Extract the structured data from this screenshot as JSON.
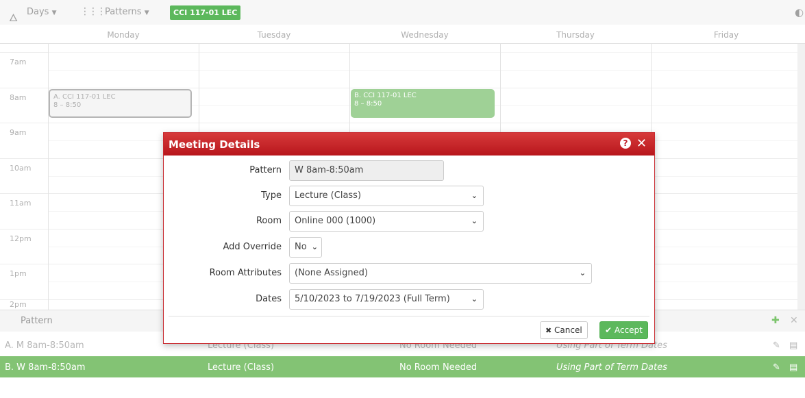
{
  "toolbar": {
    "days_label": "Days",
    "patterns_label": "Patterns",
    "course_badge": "CCI 117-01 LEC",
    "icons": [
      "fire-icon",
      "grid-icon",
      "chevron-down-icon",
      "refresh-icon"
    ]
  },
  "days": [
    "Monday",
    "Tuesday",
    "Wednesday",
    "Thursday",
    "Friday"
  ],
  "times": [
    "7am",
    "8am",
    "9am",
    "10am",
    "11am",
    "12pm",
    "1pm",
    "2pm"
  ],
  "events": {
    "a": {
      "title": "A. CCI 117-01 LEC",
      "time": "8 – 8:50"
    },
    "b": {
      "title": "B. CCI 117-01 LEC",
      "time": "8 – 8:50"
    }
  },
  "modal": {
    "title": "Meeting Details",
    "fields": {
      "pattern": {
        "label": "Pattern",
        "value": "W 8am-8:50am"
      },
      "type": {
        "label": "Type",
        "value": "Lecture (Class)"
      },
      "room": {
        "label": "Room",
        "value": "Online 000 (1000)"
      },
      "override": {
        "label": "Add Override",
        "value": "No"
      },
      "attributes": {
        "label": "Room Attributes",
        "value": "(None Assigned)"
      },
      "dates": {
        "label": "Dates",
        "value": "5/10/2023 to 7/19/2023 (Full Term)"
      }
    },
    "cancel_label": "Cancel",
    "accept_label": "Accept"
  },
  "pattern_table": {
    "header": "Pattern",
    "rows": [
      {
        "pattern": "A. M 8am-8:50am",
        "type": "Lecture (Class)",
        "room": "No Room Needed",
        "dates": "Using Part of Term Dates"
      },
      {
        "pattern": "B. W 8am-8:50am",
        "type": "Lecture (Class)",
        "room": "No Room Needed",
        "dates": "Using Part of Term Dates"
      }
    ]
  },
  "colors": {
    "accent_green": "#5cb85c",
    "selected_row": "#83c374",
    "modal_header_red": "#c0202a"
  }
}
